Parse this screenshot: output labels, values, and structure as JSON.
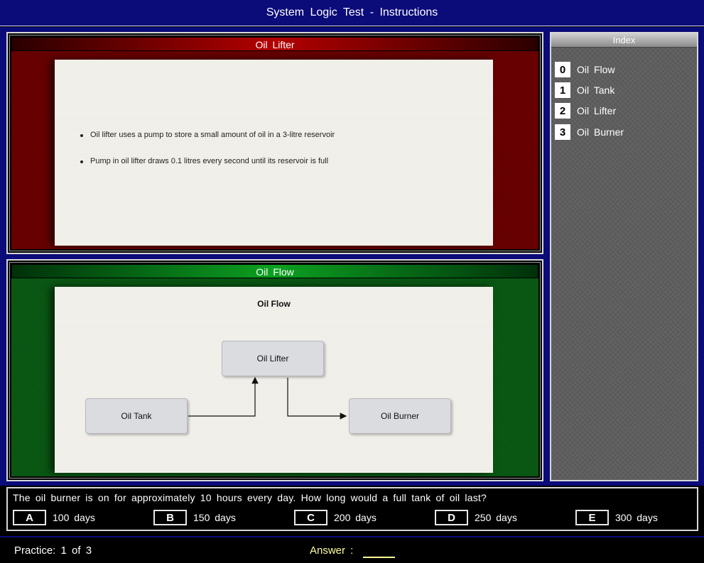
{
  "window": {
    "title": "System Logic Test - Instructions"
  },
  "top_panel": {
    "title": "Oil Lifter",
    "bullets": [
      "Oil lifter uses a pump to store a small amount of oil in a 3-litre reservoir",
      "Pump in oil lifter draws 0.1 litres every second until its reservoir is full"
    ]
  },
  "bottom_panel": {
    "title": "Oil Flow",
    "diagram": {
      "title": "Oil Flow",
      "nodes": {
        "tank": "Oil Tank",
        "lifter": "Oil Lifter",
        "burner": "Oil Burner"
      }
    }
  },
  "index": {
    "title": "Index",
    "items": [
      {
        "num": "0",
        "label": "Oil Flow"
      },
      {
        "num": "1",
        "label": "Oil Tank"
      },
      {
        "num": "2",
        "label": "Oil Lifter"
      },
      {
        "num": "3",
        "label": "Oil Burner"
      }
    ]
  },
  "question": {
    "text": "The oil burner is on for approximately 10 hours every day. How long would a full tank of oil last?",
    "options": [
      {
        "letter": "A",
        "text": "100 days"
      },
      {
        "letter": "B",
        "text": "150 days"
      },
      {
        "letter": "C",
        "text": "200 days"
      },
      {
        "letter": "D",
        "text": "250 days"
      },
      {
        "letter": "E",
        "text": "300 days"
      }
    ]
  },
  "status": {
    "practice": "Practice: 1 of 3",
    "answer_label": "Answer :"
  },
  "colors": {
    "title_bar": "#0b0b7a",
    "top_panel": "#6a0000",
    "bottom_panel": "#0a5a14",
    "answer": "#ffff99"
  }
}
